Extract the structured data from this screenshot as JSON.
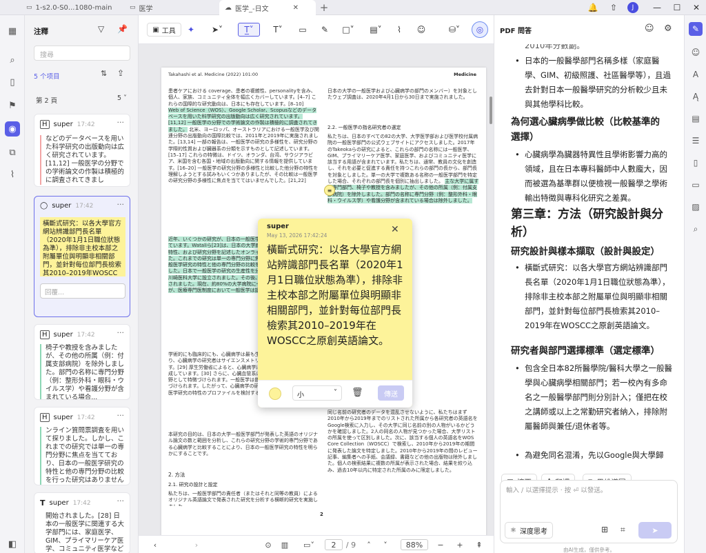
{
  "tabs": [
    {
      "label": "1-s2.0-S0...1080-main"
    },
    {
      "label": "医学"
    },
    {
      "label": "医学_-日文"
    }
  ],
  "annotations": {
    "title": "注釋",
    "search_placeholder": "搜尋",
    "count": "5 个项目",
    "page_label": "第 2 頁",
    "page_count": "5",
    "cards": [
      {
        "user": "super",
        "time": "17:42",
        "text": "などのデータベースを用いた科学研究の出版動向は広く研究されています。[11,12] 一般医学の分野での学術論文の作製は積極的に調査されてきまし"
      },
      {
        "user": "super",
        "time": "17:42",
        "text": "橫斷式研究：以各大學官方網站辨識部門長名單（2020年1月1日職位狀態為準），排除非主校本部之附屬單位與明顯非相關部門，並針對每位部門長檢索其2010–2019年WOSCC之原創英語論",
        "reply_placeholder": "回覆..."
      },
      {
        "user": "super",
        "time": "17:42",
        "text": "椅子や教授を含みましたが、その他の所属（例：付属支部病院）を除外しました。部門の名称に専門分野（例：整形外科・眼科・ウイルス学）や看護分野が含まれている場合..."
      },
      {
        "user": "super",
        "time": "17:42",
        "text": "ンライン質問票調査を用いて探りました。しかし、これまでの研究では単一の専門分野に焦点を当てており、日本の一般医学研究の特性と他の専門分野の比較を行った研究はありませんでした。"
      },
      {
        "user": "super",
        "time": "17:42",
        "text": "開始されました。[28] 日本の一般医学に関連する大学部門には、家庭医学、GIM、プライマリーケア医学、コミュニティ医学などが含まれます。[27] 学術的には臨床的にも..."
      }
    ]
  },
  "toolbar": {
    "tool_label": "工具"
  },
  "page": {
    "header_left": "Takahashi et al. Medicine (2022) 101:00",
    "header_right": "Medicine",
    "page_no": "2",
    "col1_p1_a": "患者ケアにおける coverage、患者の複雑性、personalityを含み、個人、家族、コミュニティ全体を幅広くカバーしています。[4–7] これらの国際的な研究動向は、日本にも存在しています。[8–10]",
    "col1_p1_b": "Web of Science（WOS）、Google Scholar、Scopusなどのデータベースを用いた科学研究の出版動向は広く研究されています。[11,12] 一般医学の分野での学術論文の作製は積極的に調査されてきました。",
    "col1_p1_c": "北米、ヨーロッパ、オーストラリアにおける一般医学及び関連分野の出版動向の国際比較では、2011年と2019年に実施されました。[13,14] 一部の報告は、一般医学の研究の多様性を、研究分野の学際的性質および臓器系の分類を示すものとして記述しています。[15–17] これらの特徴は、ドイツ、オランダ、台湾、サウジアラビア、米国を含む各国・地域の出版動向に関する情報を提供しています。[16–20] 一般医学の研究分野の多様性と比較した他分野の特性を理解しようとする試みもいくつかありましたが、その比較は一般医学の研究分野の多様性に焦点を当ててはいませんでした。[21,22]",
    "col1_p2": "近年、いくつかの研究が、日本の一般医学の研究の生産に焦点を当てています。Wataliら[23]は、日本の大学病院における一般医学部門の特性、および研究分野を記述したオンライン質問票調査を実施しました。これまでの研究は単一の専門分野に焦点を当てており、日本の一般医学研究の特性と他の専門分野の比較を行った研究はありませんでした。日本で一般医学の研究の生産性を分析した学部門は1981年に川崎医科大学に設立されました。その後、全国各地で医科大学が設立されました。現在、約80%の大学病院に一般医学部門がありましたが、医療専門医制度において一般医学は認められていませんでした。",
    "col1_p3": "学術的にも臨床的にも、心臓病学は最も生産的な医学分野の一つであり、心臓病学の研究者はサイエンスメトリクス分析を使用しています。[29] 厚生労働省によると、心臓病学は日本の最大のグループを構成しています。[30] さらに、心臓血管系に限定された臓器特異的な分野として特徴づけられます。一般医学は普遍的な医療分野として特徴づけられます。したがって、心臓病学の研究と比較することで、一般医学研究の特性のプロファイルを検討することを可能にします。",
    "col1_p4": "本研究の目的は、日本の大学一般医学部門が発表した英語のオリジナル論文の数と範囲を分析し、これらの研究分野の学術的専門分野である心臓病学と比較することにより、日本の一般医学研究の特性を明らかにすることです。",
    "sec2": "2. 方法",
    "sec21": "2.1. 研究の設計と設定",
    "col1_p5": "私たちは、一般医学部門の責任者（またはそれと同等の教員）によるオリジナル英語論文で発表された研究を分析する横断的研究を実施しました。",
    "col2_p1": "日本の大学の一般医学および心臓病学の部門のメンバー）を対象としたウェブ調査は、2020年4月1日から30日まで実施されました。",
    "sec22": "2.2. 一般医学の指名研究者の選定",
    "col2_p2": "私たちは、日本のすべての82の大学、大学医学部および医学校付属病院の一般医学部門の公式ウェブサイトにアクセスしました。2017年のTakeokaらの研究によると、これらの部門の名称には一般医学、GIM、プライマリーケア医学、家庭医学、およびコミュニティ医学に該当する用語が含まれています。私たちは、通常、教員の文化を創造し、それを必要と促進する責任を持つこれらの部門の長から、部門長を対象としました。単一の大学で複数ある名称の一般医学部門を特定した場合、それぞれの部門長を個別に抽出しました。",
    "col2_p2_hl": "主な大学に属する専門部門、椅子や教授を含みましたが、その他の所属（例：付属支部病院）を除外しました。部門の名称に専門分野（例：整形外科・眼科・ウイルス学）や看護分野が含まれている場合は除外しました。",
    "col2_p3": "同じ名前の研究者のデータを混乱させないように、私たちはまず2010年から2019年までのリストされた所属から各研究者の英語名をGoogle検索に入力し、その大学に同じ名前の別の人物がいるかどうかを確認しました。2人の同名の人物が見つかった場合、大学リストの所属を使って区別しました。次に、該当する個人の英語名をWOS Core Collection（WOSCC）で検索し、2010年から2019年の期間に発表した論文を特定しました。2010年から2019年の間のレビュー記事、編集者への手紙、会議録、書籍などの他の出版物は除外しました。個人の検索結果に複数の所属が表示された場合、結果を絞り込み、過去10年以内に特定された所属のみに限定しました。"
  },
  "note": {
    "user": "super",
    "date": "May 13, 2026 17:42:24",
    "text": "橫斷式研究：以各大學官方網站辨識部門長名單（2020年1月1日職位狀態為準），排除非主校本部之附屬單位與明顯非相關部門，並針對每位部門長檢索其2010–2019年在WOSCC之原創英語論文。",
    "size": "小",
    "send": "傳送",
    "color": "#fdf39a"
  },
  "docbar": {
    "page_current": "2",
    "page_total": "/ 9",
    "zoom": "88%"
  },
  "chat": {
    "title": "PDF 問答",
    "top_cut": "2010年分數副。",
    "items": [
      {
        "type": "bullet",
        "text": "日本的一般醫學部門名稱多樣（家庭醫學、GIM、初級照護、社區醫學等），且過去針對日本一般醫學研究的分析較少且未與其他學科比較。"
      },
      {
        "type": "h3",
        "text": "為何選心臟病學做比較（比較基準的選擇）"
      },
      {
        "type": "bullet",
        "text": "心臟病學為臟器特異性且學術影響力高的領域，且在日本專科醫師中人數龐大，因而被選為基準群以便檢視一般醫學之學術輸出特徵與專科化研究之差異。"
      },
      {
        "type": "h2",
        "text": "第三章：方法（研究設計與分析）"
      },
      {
        "type": "h3",
        "text": "研究設計與樣本擷取（設計與設定）"
      },
      {
        "type": "bullet",
        "text": "橫斷式研究：以各大學官方網站辨識部門長名單（2020年1月1日職位狀態為準），排除非主校本部之附屬單位與明顯非相關部門，並針對每位部門長檢索其2010–2019年在WOSCC之原創英語論文。"
      },
      {
        "type": "h3",
        "text": "研究者與部門選擇標準（選定標準）"
      },
      {
        "type": "bullet",
        "text": "包含全日本82所醫學院/醫科大學之一般醫學與心臟病學相關部門；若一校內有多命名之一般醫學部門則分別計入；僅把在校之講師或以上之常勤研究者納入，排除附屬醫師與兼任/退休者等。"
      },
      {
        "type": "bullet",
        "text": "為避免同名混淆，先以Google與大學歸"
      }
    ],
    "actions": [
      {
        "label": "摘要"
      },
      {
        "label": "翻譯"
      },
      {
        "label": "思維導圖"
      }
    ],
    "input_placeholder": "輸入 / 以選擇提示 · 按 ⏎ 以發送。",
    "deep_think": "深度思考",
    "footer": "由AI生成，僅供參考。"
  }
}
